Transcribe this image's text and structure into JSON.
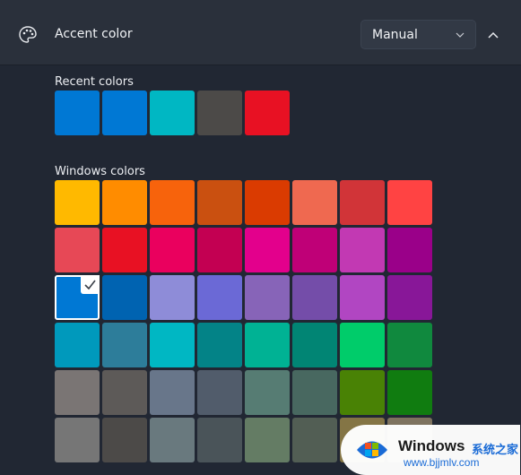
{
  "header": {
    "title": "Accent color",
    "icon": "palette-icon",
    "mode_dropdown": {
      "selected": "Manual",
      "icon": "chevron-down-icon"
    },
    "collapse_icon": "chevron-up-icon"
  },
  "recent": {
    "label": "Recent colors",
    "colors": [
      "#0078d4",
      "#0078d4",
      "#00b7c3",
      "#4c4a48",
      "#e81123"
    ]
  },
  "windows": {
    "label": "Windows colors",
    "selected_index": 16,
    "colors": [
      "#ffb900",
      "#ff8c00",
      "#f7630c",
      "#ca5010",
      "#da3b01",
      "#ef6950",
      "#d13438",
      "#ff4343",
      "#e74856",
      "#e81123",
      "#ea005e",
      "#c30052",
      "#e3008c",
      "#bf0077",
      "#c239b3",
      "#9a0089",
      "#0078d4",
      "#0063b1",
      "#8e8cd8",
      "#6b69d6",
      "#8764b8",
      "#744da9",
      "#b146c2",
      "#881798",
      "#0099bc",
      "#2d7d9a",
      "#00b7c3",
      "#038387",
      "#00b294",
      "#018574",
      "#00cc6a",
      "#10893e",
      "#7a7574",
      "#5d5a58",
      "#68768a",
      "#515c6b",
      "#567c73",
      "#486860",
      "#498205",
      "#107c10",
      "#767676",
      "#4c4a48",
      "#69797e",
      "#4a5459",
      "#647c64",
      "#525e54",
      "#847545",
      "#7e735f"
    ]
  },
  "watermark": {
    "title": "Windows",
    "subtitle": "系统之家",
    "url": "www.bjjmlv.com"
  }
}
